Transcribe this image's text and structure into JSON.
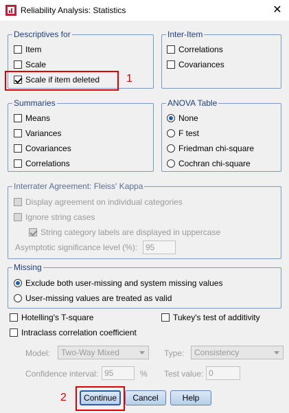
{
  "window": {
    "title": "Reliability Analysis: Statistics",
    "close_glyph": "✕"
  },
  "descriptives": {
    "legend": "Descriptives for",
    "item": "Item",
    "scale": "Scale",
    "scale_if_deleted": "Scale if item deleted"
  },
  "inter_item": {
    "legend": "Inter-Item",
    "correlations": "Correlations",
    "covariances": "Covariances"
  },
  "summaries": {
    "legend": "Summaries",
    "means": "Means",
    "variances": "Variances",
    "covariances": "Covariances",
    "correlations": "Correlations"
  },
  "anova": {
    "legend": "ANOVA Table",
    "none": "None",
    "f_test": "F test",
    "friedman": "Friedman chi-square",
    "cochran": "Cochran chi-square"
  },
  "interrater": {
    "legend": "Interrater Agreement: Fleiss' Kappa",
    "display_agreement": "Display agreement on individual categories",
    "ignore_case": "Ignore string cases",
    "uppercase": "String category labels are displayed in uppercase",
    "asymptotic_label": "Asymptotic significance level (%):",
    "asymptotic_value": "95"
  },
  "missing": {
    "legend": "Missing",
    "exclude": "Exclude both user-missing and system missing values",
    "valid": "User-missing values are treated as valid"
  },
  "options": {
    "hotelling": "Hotelling's T-square",
    "tukey": "Tukey's test of additivity",
    "intraclass": "Intraclass correlation coefficient"
  },
  "icc": {
    "model_label": "Model:",
    "model_value": "Two-Way Mixed",
    "type_label": "Type:",
    "type_value": "Consistency",
    "ci_label": "Confidence interval:",
    "ci_value": "95",
    "ci_unit": "%",
    "test_label": "Test value:",
    "test_value": "0"
  },
  "buttons": {
    "continue": "Continue",
    "cancel": "Cancel",
    "help": "Help"
  },
  "annotations": {
    "marker_1": "1",
    "marker_2": "2"
  },
  "colors": {
    "accent": "#1a5fb4",
    "annotation": "#e00000",
    "group_border": "#7a9ac6"
  }
}
